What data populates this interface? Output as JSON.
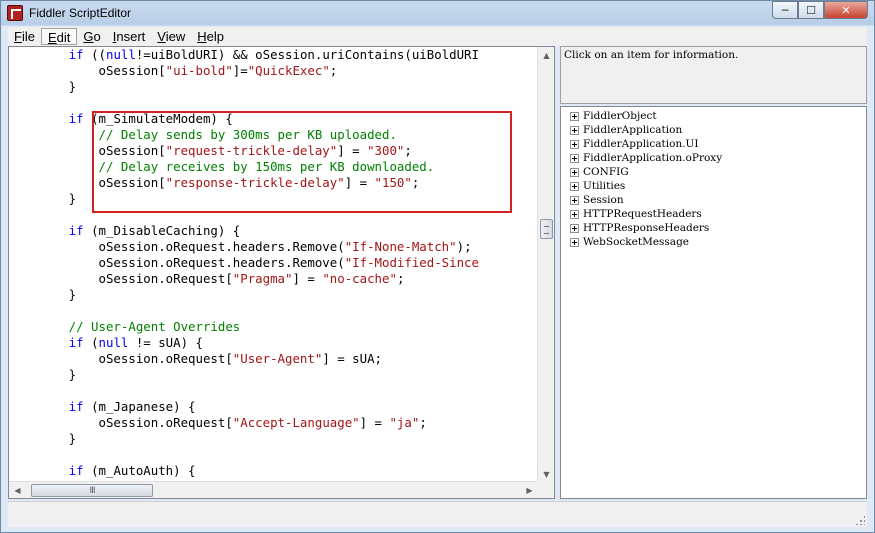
{
  "window": {
    "title": "Fiddler ScriptEditor",
    "minimize_glyph": "─",
    "maximize_glyph": "☐",
    "close_glyph": "✕"
  },
  "menu": [
    {
      "label": "File",
      "underline": "F",
      "rest": "ile"
    },
    {
      "label": "Edit",
      "underline": "E",
      "rest": "dit"
    },
    {
      "label": "Go",
      "underline": "G",
      "rest": "o"
    },
    {
      "label": "Insert",
      "underline": "I",
      "rest": "nsert"
    },
    {
      "label": "View",
      "underline": "V",
      "rest": "iew"
    },
    {
      "label": "Help",
      "underline": "H",
      "rest": "elp"
    }
  ],
  "editor": {
    "lines": [
      [
        [
          "kw",
          "        if "
        ],
        [
          "",
          "(("
        ],
        [
          "kw",
          "null"
        ],
        [
          "",
          "!=uiBoldURI) && oSession.uriContains(uiBoldURI"
        ]
      ],
      [
        [
          "",
          "            oSession["
        ],
        [
          "str",
          "\"ui-bold\""
        ],
        [
          "",
          "]="
        ],
        [
          "str",
          "\"QuickExec\""
        ],
        [
          "",
          ";"
        ]
      ],
      [
        [
          "",
          "        }"
        ]
      ],
      [
        [
          "",
          ""
        ]
      ],
      [
        [
          "kw",
          "        if "
        ],
        [
          "",
          "(m_SimulateModem) {"
        ]
      ],
      [
        [
          "cm",
          "            // Delay sends by 300ms per KB uploaded."
        ]
      ],
      [
        [
          "",
          "            oSession["
        ],
        [
          "str",
          "\"request-trickle-delay\""
        ],
        [
          "",
          "] = "
        ],
        [
          "str",
          "\"300\""
        ],
        [
          "",
          ";"
        ]
      ],
      [
        [
          "cm",
          "            // Delay receives by 150ms per KB downloaded."
        ]
      ],
      [
        [
          "",
          "            oSession["
        ],
        [
          "str",
          "\"response-trickle-delay\""
        ],
        [
          "",
          "] = "
        ],
        [
          "str",
          "\"150\""
        ],
        [
          "",
          ";"
        ]
      ],
      [
        [
          "",
          "        }"
        ]
      ],
      [
        [
          "",
          ""
        ]
      ],
      [
        [
          "kw",
          "        if "
        ],
        [
          "",
          "(m_DisableCaching) {"
        ]
      ],
      [
        [
          "",
          "            oSession.oRequest.headers.Remove("
        ],
        [
          "str",
          "\"If-None-Match\""
        ],
        [
          "",
          ");"
        ]
      ],
      [
        [
          "",
          "            oSession.oRequest.headers.Remove("
        ],
        [
          "str",
          "\"If-Modified-Since"
        ]
      ],
      [
        [
          "",
          "            oSession.oRequest["
        ],
        [
          "str",
          "\"Pragma\""
        ],
        [
          "",
          "] = "
        ],
        [
          "str",
          "\"no-cache\""
        ],
        [
          "",
          ";"
        ]
      ],
      [
        [
          "",
          "        }"
        ]
      ],
      [
        [
          "",
          ""
        ]
      ],
      [
        [
          "cm",
          "        // User-Agent Overrides"
        ]
      ],
      [
        [
          "kw",
          "        if "
        ],
        [
          "",
          "("
        ],
        [
          "kw",
          "null"
        ],
        [
          "",
          " != sUA) {"
        ]
      ],
      [
        [
          "",
          "            oSession.oRequest["
        ],
        [
          "str",
          "\"User-Agent\""
        ],
        [
          "",
          "] = sUA;"
        ]
      ],
      [
        [
          "",
          "        }"
        ]
      ],
      [
        [
          "",
          ""
        ]
      ],
      [
        [
          "kw",
          "        if "
        ],
        [
          "",
          "(m_Japanese) {"
        ]
      ],
      [
        [
          "",
          "            oSession.oRequest["
        ],
        [
          "str",
          "\"Accept-Language\""
        ],
        [
          "",
          "] = "
        ],
        [
          "str",
          "\"ja\""
        ],
        [
          "",
          ";"
        ]
      ],
      [
        [
          "",
          "        }"
        ]
      ],
      [
        [
          "",
          ""
        ]
      ],
      [
        [
          "kw",
          "        if "
        ],
        [
          "",
          "(m_AutoAuth) {"
        ]
      ]
    ],
    "hscroll_thumb_glyph": "III"
  },
  "info_panel": {
    "text": "Click on an item for information."
  },
  "tree": [
    "FiddlerObject",
    "FiddlerApplication",
    "FiddlerApplication.UI",
    "FiddlerApplication.oProxy",
    "CONFIG",
    "Utilities",
    "Session",
    "HTTPRequestHeaders",
    "HTTPResponseHeaders",
    "WebSocketMessage"
  ],
  "colors": {
    "keyword": "#0000ff",
    "string": "#a31515",
    "comment": "#008000",
    "highlight_box": "#d42020"
  }
}
